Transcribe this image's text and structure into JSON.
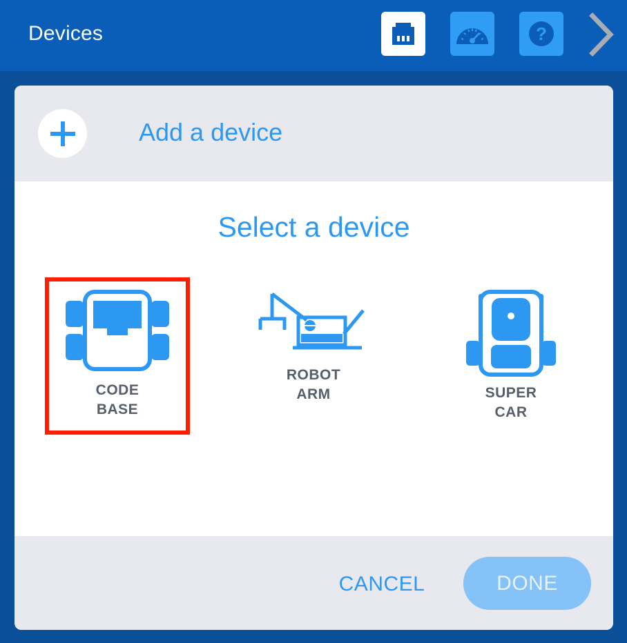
{
  "topbar": {
    "title": "Devices",
    "buttons": [
      {
        "icon": "ethernet-port-icon",
        "active": true
      },
      {
        "icon": "gauge-icon",
        "active": false
      },
      {
        "icon": "help-icon",
        "glyph": "?",
        "active": false
      }
    ],
    "next_icon": "chevron-right-icon"
  },
  "dialog": {
    "add_device_label": "Add a device",
    "select_title": "Select a device",
    "devices": [
      {
        "id": "code-base",
        "line1": "CODE",
        "line2": "BASE",
        "selected": true
      },
      {
        "id": "robot-arm",
        "line1": "ROBOT",
        "line2": "ARM",
        "selected": false
      },
      {
        "id": "super-car",
        "line1": "SUPER",
        "line2": "CAR",
        "selected": false
      }
    ],
    "cancel_label": "CANCEL",
    "done_label": "DONE"
  },
  "colors": {
    "topbar": "#0a5eb7",
    "background": "#0b4f98",
    "accent": "#2c98f2",
    "selection": "#ff1e00",
    "done_disabled": "#85c2f7"
  }
}
